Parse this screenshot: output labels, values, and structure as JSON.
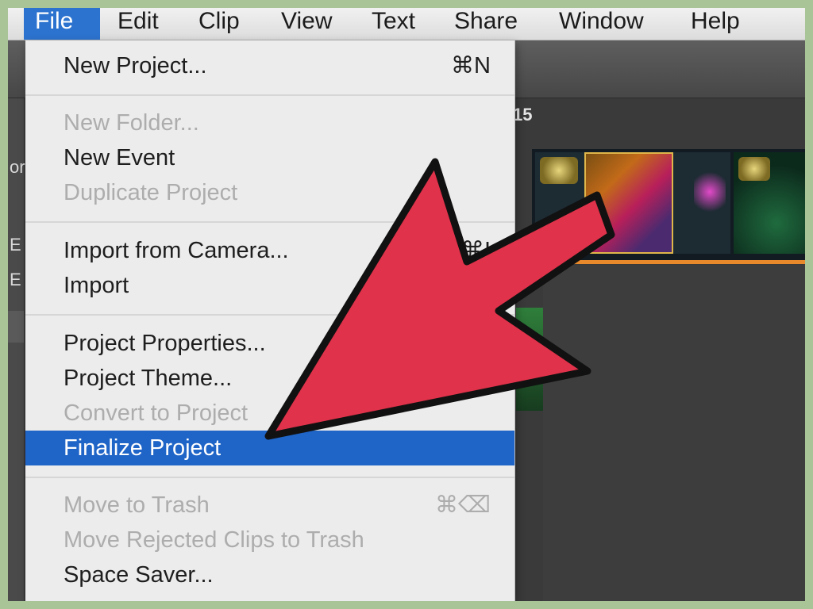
{
  "menubar": {
    "items": [
      "File",
      "Edit",
      "Clip",
      "View",
      "Text",
      "Share",
      "Window",
      "Help"
    ]
  },
  "app": {
    "sidebar_labels": [
      "or",
      "E",
      "E"
    ],
    "date_header": "15"
  },
  "file_menu": {
    "new_project": "New Project...",
    "new_project_shortcut": "⌘N",
    "new_folder": "New Folder...",
    "new_event": "New Event",
    "duplicate_project": "Duplicate Project",
    "import_from_camera": "Import from Camera...",
    "import_from_camera_shortcut": "⌘I",
    "import": "Import",
    "project_properties": "Project Properties...",
    "project_theme": "Project Theme...",
    "convert_to_project": "Convert to Project",
    "finalize_project": "Finalize Project",
    "move_to_trash": "Move to Trash",
    "move_to_trash_shortcut": "⌘⌫",
    "move_rejected_clips": "Move Rejected Clips to Trash",
    "space_saver": "Space Saver..."
  },
  "colors": {
    "menu_highlight": "#1f64c7",
    "annotation_arrow": "#e0324a"
  }
}
